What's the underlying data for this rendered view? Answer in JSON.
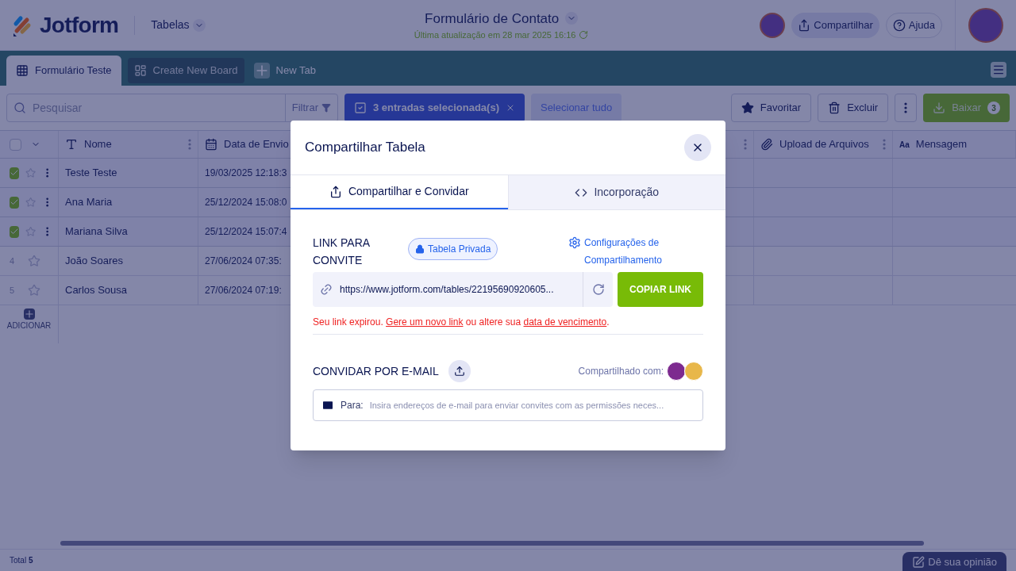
{
  "header": {
    "logo": "Jotform",
    "menu": "Tabelas",
    "title": "Formulário de Contato",
    "subtitle": "Última atualização em 28 mar 2025 16:16",
    "share": "Compartilhar",
    "help": "Ajuda"
  },
  "tabs": [
    {
      "kind": "table",
      "label": "Formulário Teste",
      "selected": true
    },
    {
      "kind": "board",
      "label": "Create New Board",
      "selected": false
    },
    {
      "kind": "new",
      "label": "New Tab",
      "selected": false
    }
  ],
  "toolbar": {
    "search_placeholder": "Pesquisar",
    "filter": "Filtrar",
    "selection": "3 entradas selecionada(s)",
    "select_all": "Selecionar tudo",
    "favorite": "Favoritar",
    "delete": "Excluir",
    "download": "Baixar",
    "download_count": "3"
  },
  "table": {
    "columns": [
      {
        "kind": "text",
        "label": "Nome"
      },
      {
        "kind": "date",
        "label": "Data de Envio"
      },
      {
        "kind": "blank"
      },
      {
        "kind": "file",
        "label": "Upload de Arquivos"
      },
      {
        "kind": "message",
        "icon_text": "Aa",
        "label": "Mensagem"
      }
    ],
    "all_checked": false,
    "rows": [
      {
        "checked": true,
        "name": "Teste Teste",
        "date": "19/03/2025 12:18:3"
      },
      {
        "checked": true,
        "name": "Ana Maria",
        "date": "25/12/2024 15:08:0"
      },
      {
        "checked": true,
        "name": "Mariana Silva",
        "date": "25/12/2024 15:07:4"
      },
      {
        "index": "4",
        "checked": false,
        "name": "João Soares",
        "date": "27/06/2024 07:35:"
      },
      {
        "index": "5",
        "checked": false,
        "name": "Carlos Sousa",
        "date": "27/06/2024 07:19:"
      }
    ],
    "add": "ADICIONAR"
  },
  "footer": {
    "total_label": "Total",
    "total": "5",
    "feedback": "Dê sua opinião"
  },
  "modal": {
    "title": "Compartilhar Tabela",
    "tabs": [
      {
        "kind": "share",
        "label": "Compartilhar e Convidar",
        "selected": true
      },
      {
        "kind": "embed",
        "label": "Incorporação",
        "selected": false
      }
    ],
    "link_label": "LINK PARA CONVITE",
    "privacy": "Tabela Privada",
    "settings": "Configurações de Compartilhamento",
    "url": "https://www.jotform.com/tables/22195690920605...",
    "copy": "COPIAR LINK",
    "error": [
      {
        "kind": "text",
        "text": "Seu link expirou. "
      },
      {
        "kind": "link",
        "text": "Gere um novo link"
      },
      {
        "kind": "text",
        "text": " ou altere sua "
      },
      {
        "kind": "link",
        "text": "data de vencimento"
      },
      {
        "kind": "text",
        "text": "."
      }
    ],
    "invite_label": "CONVIDAR POR E-MAIL",
    "shared_with": "Compartilhado com:",
    "to_label": "Para:",
    "email_placeholder": "Insira endereços de e-mail para enviar convites com as permissões neces..."
  }
}
